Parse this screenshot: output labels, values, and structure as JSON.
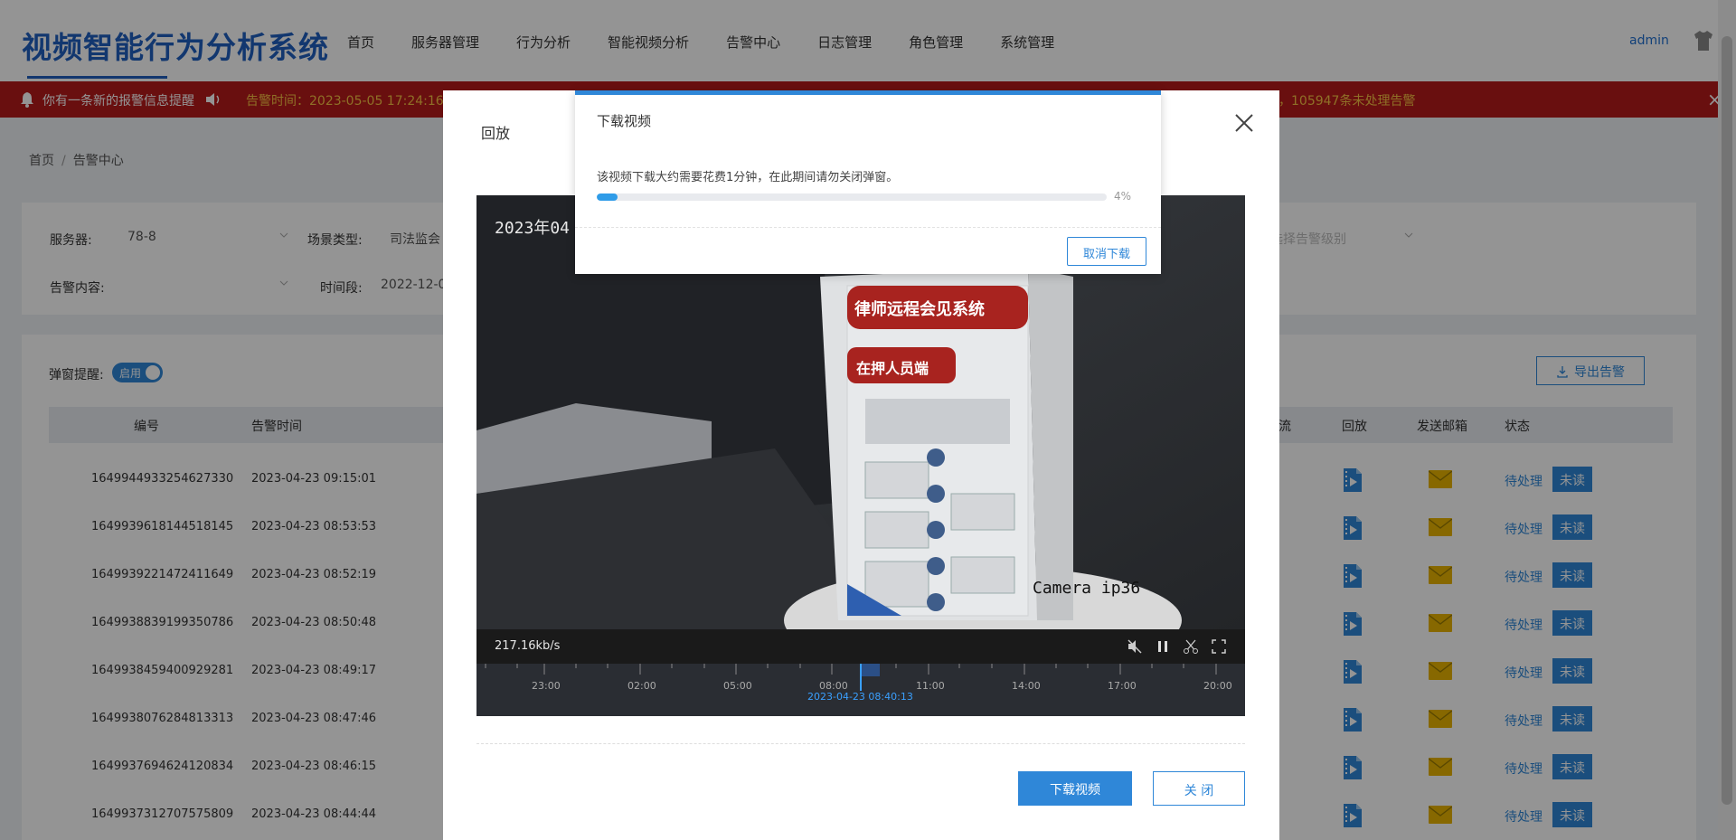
{
  "header": {
    "app_title": "视频智能行为分析系统",
    "nav": [
      "首页",
      "服务器管理",
      "行为分析",
      "智能视频分析",
      "告警中心",
      "日志管理",
      "角色管理",
      "系统管理"
    ],
    "user": "admin"
  },
  "alarm_bar": {
    "message": "你有一条新的报警信息提醒",
    "time_label": "告警时间：2023-05-05 17:24:16",
    "count_text": "，105947条未处理告警"
  },
  "breadcrumb": [
    "首页",
    "告警中心"
  ],
  "filters": {
    "server_label": "服务器:",
    "server_value": "78-8",
    "scene_label": "场景类型:",
    "scene_value": "司法监会",
    "alarm_level_placeholder": "选择告警级别",
    "content_label": "告警内容:",
    "period_label": "时间段:",
    "period_value": "2022-12-0"
  },
  "table": {
    "popup_label": "弹窗提醒:",
    "popup_toggle": "启用",
    "export_label": "导出告警",
    "headers": {
      "id": "编号",
      "time": "告警时间",
      "col_trunc": "流",
      "playback": "回放",
      "mail": "发送邮箱",
      "status": "状态"
    },
    "rows": [
      {
        "id": "1649944933254627330",
        "time": "2023-04-23 09:15:01",
        "status": "待处理",
        "read": "未读"
      },
      {
        "id": "1649939618144518145",
        "time": "2023-04-23 08:53:53",
        "status": "待处理",
        "read": "未读"
      },
      {
        "id": "1649939221472411649",
        "time": "2023-04-23 08:52:19",
        "status": "待处理",
        "read": "未读"
      },
      {
        "id": "1649938839199350786",
        "time": "2023-04-23 08:50:48",
        "status": "待处理",
        "read": "未读"
      },
      {
        "id": "1649938459400929281",
        "time": "2023-04-23 08:49:17",
        "status": "待处理",
        "read": "未读"
      },
      {
        "id": "1649938076284813313",
        "time": "2023-04-23 08:47:46",
        "status": "待处理",
        "read": "未读"
      },
      {
        "id": "1649937694624120834",
        "time": "2023-04-23 08:46:15",
        "status": "待处理",
        "read": "未读"
      },
      {
        "id": "1649937312707575809",
        "time": "2023-04-23 08:44:44",
        "status": "待处理",
        "read": "未读"
      }
    ]
  },
  "playback_modal": {
    "title": "回放",
    "osd_time": "2023年04",
    "osd_camera": "Camera ip36",
    "sign_title": "律师远程会见系统",
    "sign_subtitle": "在押人员端",
    "bitrate": "217.16kb/s",
    "timeline_labels": [
      "23:00",
      "02:00",
      "05:00",
      "08:00",
      "11:00",
      "14:00",
      "17:00",
      "20:00"
    ],
    "cursor_time": "2023-04-23 08:40:13",
    "download_button": "下载视频",
    "close_button": "关 闭"
  },
  "download_dialog": {
    "title": "下载视频",
    "message": "该视频下载大约需要花费1分钟，在此期间请勿关闭弹窗。",
    "progress_percent": 4,
    "progress_text": "4%",
    "cancel_button": "取消下载"
  },
  "colors": {
    "brand_blue": "#1f5fbf",
    "accent_blue": "#2f87d8",
    "alarm_red": "#b51a1a",
    "alarm_highlight": "#f6c244",
    "mail_yellow": "#e8b400"
  }
}
